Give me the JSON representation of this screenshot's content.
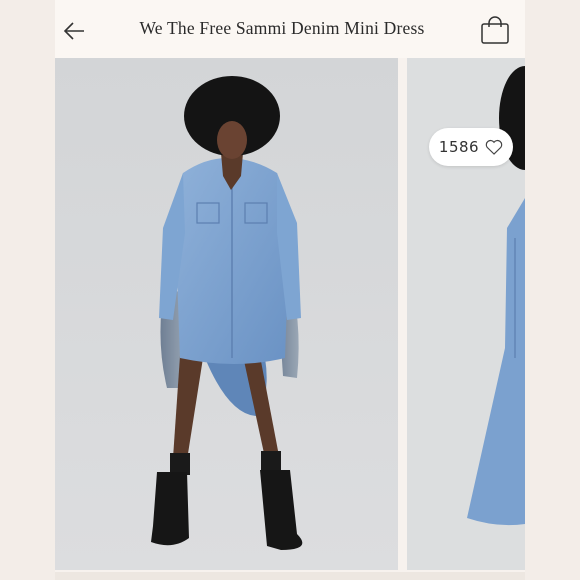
{
  "header": {
    "title": "We The Free Sammi Denim Mini Dress",
    "back_icon": "arrow-left-icon",
    "bag_icon": "shopping-bag-icon"
  },
  "listing": {
    "like_count": "1586",
    "like_icon": "heart-outline-icon"
  },
  "colors": {
    "background": "#f3ede8",
    "denim": "#7ba1cf",
    "text": "#2a2a2a"
  }
}
